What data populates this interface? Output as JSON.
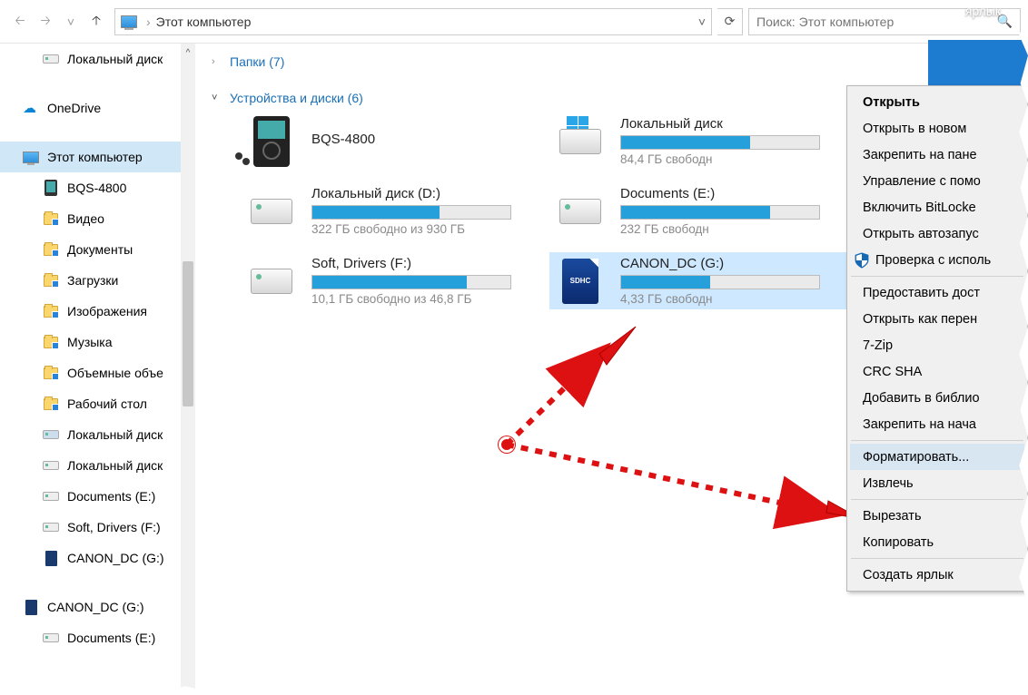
{
  "nav": {
    "breadcrumb": "Этот компьютер",
    "search_placeholder": "Поиск: Этот компьютер"
  },
  "flyout_label": "ярлык",
  "sidebar": {
    "items": [
      {
        "label": "Локальный диск",
        "icon": "hdd",
        "indent": 1
      },
      {
        "label": "OneDrive",
        "icon": "onedrive",
        "indent": 0
      },
      {
        "label": "Этот компьютер",
        "icon": "pc",
        "indent": 0,
        "selected": true
      },
      {
        "label": "BQS-4800",
        "icon": "phone",
        "indent": 1
      },
      {
        "label": "Видео",
        "icon": "folder",
        "indent": 1
      },
      {
        "label": "Документы",
        "icon": "folder",
        "indent": 1
      },
      {
        "label": "Загрузки",
        "icon": "folder",
        "indent": 1
      },
      {
        "label": "Изображения",
        "icon": "folder",
        "indent": 1
      },
      {
        "label": "Музыка",
        "icon": "folder",
        "indent": 1
      },
      {
        "label": "Объемные объе",
        "icon": "folder",
        "indent": 1
      },
      {
        "label": "Рабочий стол",
        "icon": "folder",
        "indent": 1
      },
      {
        "label": "Локальный диск",
        "icon": "hdd-win",
        "indent": 1
      },
      {
        "label": "Локальный диск",
        "icon": "hdd",
        "indent": 1
      },
      {
        "label": "Documents (E:)",
        "icon": "hdd",
        "indent": 1
      },
      {
        "label": "Soft, Drivers (F:)",
        "icon": "hdd",
        "indent": 1
      },
      {
        "label": "CANON_DC (G:)",
        "icon": "sd",
        "indent": 1
      },
      {
        "label": "CANON_DC (G:)",
        "icon": "sd",
        "indent": 0
      },
      {
        "label": "Documents (E:)",
        "icon": "hdd",
        "indent": 1
      }
    ]
  },
  "sections": {
    "folders": {
      "label": "Папки (7)",
      "expanded": false
    },
    "drives": {
      "label": "Устройства и диски (6)",
      "expanded": true
    }
  },
  "drives": [
    {
      "name": "BQS-4800",
      "type": "player",
      "bar": null,
      "free": ""
    },
    {
      "name": "Локальный диск",
      "type": "hdd-win",
      "fill": 65,
      "free": "84,4 ГБ свободн"
    },
    {
      "name": "Локальный диск (D:)",
      "type": "hdd",
      "fill": 64,
      "free": "322 ГБ свободно из 930 ГБ"
    },
    {
      "name": "Documents (E:)",
      "type": "hdd",
      "fill": 75,
      "free": "232 ГБ свободн"
    },
    {
      "name": "Soft, Drivers (F:)",
      "type": "hdd",
      "fill": 78,
      "free": "10,1 ГБ свободно из 46,8 ГБ"
    },
    {
      "name": "CANON_DC (G:)",
      "type": "sd",
      "fill": 45,
      "free": "4,33 ГБ свободн",
      "selected": true
    }
  ],
  "ctx": {
    "items": [
      {
        "label": "Открыть",
        "bold": true
      },
      {
        "label": "Открыть в новом "
      },
      {
        "label": "Закрепить на пане"
      },
      {
        "label": "Управление с помо"
      },
      {
        "label": "Включить BitLocke"
      },
      {
        "label": "Открыть автозапус"
      },
      {
        "label": "Проверка с исполь",
        "shield": true
      },
      {
        "sep": true
      },
      {
        "label": "Предоставить дост"
      },
      {
        "label": "Открыть как перен"
      },
      {
        "label": "7-Zip"
      },
      {
        "label": "CRC SHA"
      },
      {
        "label": "Добавить в библио"
      },
      {
        "label": "Закрепить на нача"
      },
      {
        "sep": true
      },
      {
        "label": "Форматировать...",
        "hl": true
      },
      {
        "label": "Извлечь"
      },
      {
        "sep": true
      },
      {
        "label": "Вырезать"
      },
      {
        "label": "Копировать"
      },
      {
        "sep": true
      },
      {
        "label": "Создать ярлык"
      }
    ]
  }
}
